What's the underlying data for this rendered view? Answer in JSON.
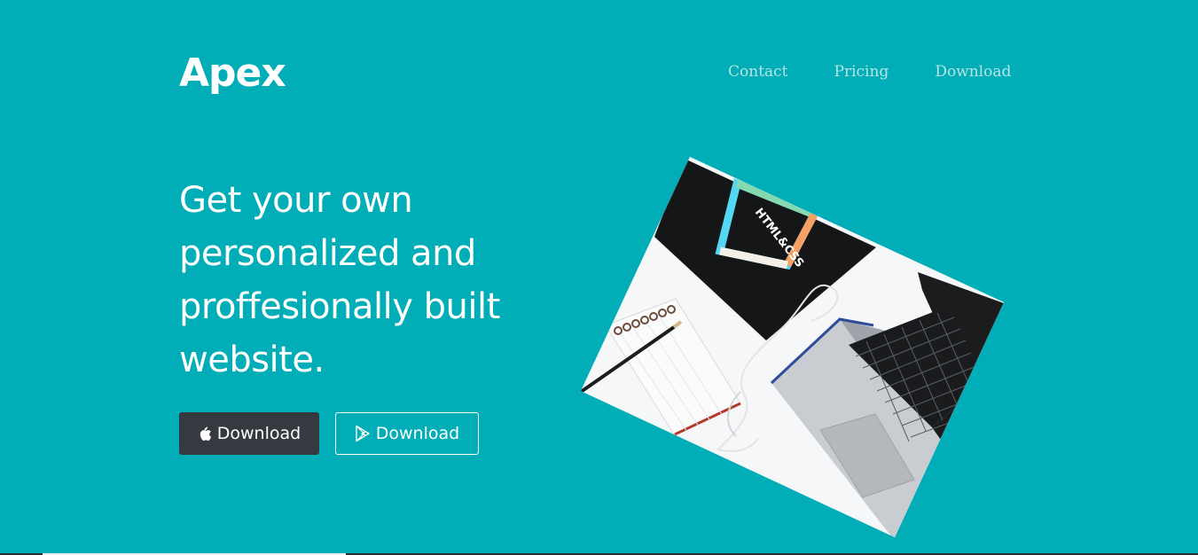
{
  "navbar": {
    "brand": "Apex",
    "links": {
      "contact": "Contact",
      "pricing": "Pricing",
      "download": "Download"
    }
  },
  "hero": {
    "title": "Get your own personalized and proffesionally built website.",
    "buttons": {
      "apple_label": "Download",
      "apple_icon": "apple-icon",
      "play_label": "Download",
      "play_icon": "google-play-icon"
    },
    "image": {
      "book_title": "HTML&CSS"
    }
  },
  "colors": {
    "background": "#01adb6",
    "dark_button": "#343a40",
    "text": "#ffffff"
  }
}
